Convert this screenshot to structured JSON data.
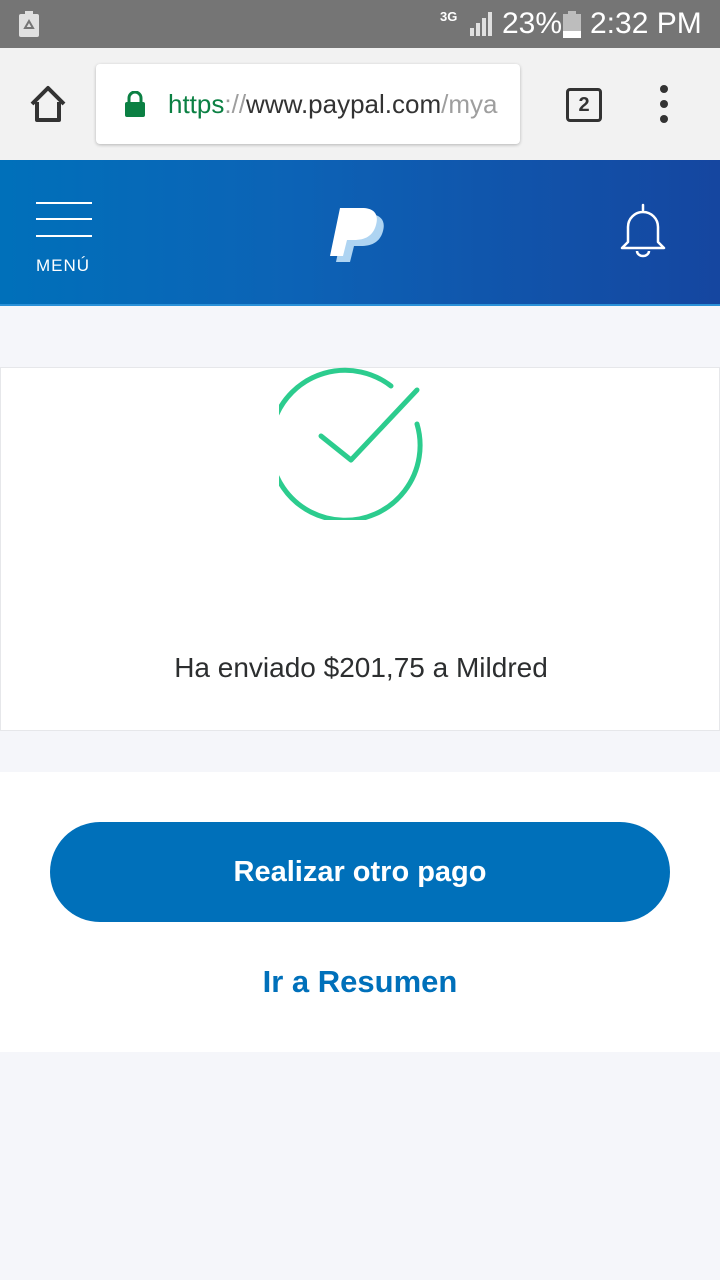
{
  "status_bar": {
    "network": "3G",
    "battery_percent": "23%",
    "time": "2:32 PM"
  },
  "browser": {
    "url_scheme": "https",
    "url_sep": "://",
    "url_host": "www.paypal.com",
    "url_path": "/mya",
    "tab_count": "2"
  },
  "header": {
    "menu_label": "MENÚ"
  },
  "confirmation": {
    "message": "Ha enviado $201,75 a Mildred"
  },
  "actions": {
    "primary_label": "Realizar otro pago",
    "secondary_label": "Ir a Resumen"
  },
  "colors": {
    "brand_blue": "#0070ba",
    "success_green": "#2ccc8e",
    "secure_green": "#0b8043"
  }
}
